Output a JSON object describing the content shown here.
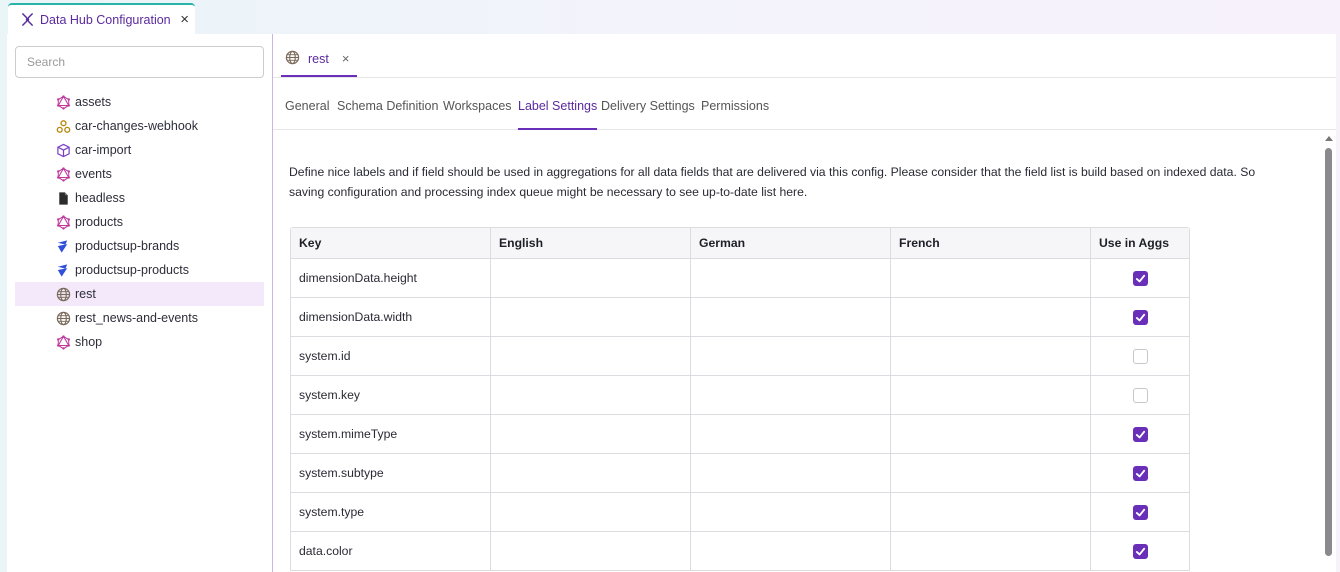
{
  "app_tab": {
    "title": "Data Hub Configuration",
    "icon": "datahub-sparkle-icon",
    "accent": "#28b5a8"
  },
  "search": {
    "placeholder": "Search",
    "value": ""
  },
  "tree": [
    {
      "label": "assets",
      "icon": "graphql-icon",
      "active": false
    },
    {
      "label": "car-changes-webhook",
      "icon": "webhook-icon",
      "active": false
    },
    {
      "label": "car-import",
      "icon": "cube-icon",
      "active": false
    },
    {
      "label": "events",
      "icon": "graphql-icon",
      "active": false
    },
    {
      "label": "headless",
      "icon": "document-icon",
      "active": false
    },
    {
      "label": "products",
      "icon": "graphql-icon",
      "active": false
    },
    {
      "label": "productsup-brands",
      "icon": "productsup-icon",
      "active": false
    },
    {
      "label": "productsup-products",
      "icon": "productsup-icon",
      "active": false
    },
    {
      "label": "rest",
      "icon": "globe-icon",
      "active": true
    },
    {
      "label": "rest_news-and-events",
      "icon": "globe-icon",
      "active": false
    },
    {
      "label": "shop",
      "icon": "graphql-icon",
      "active": false
    }
  ],
  "doc_tab": {
    "label": "rest",
    "icon": "globe-icon",
    "close": "×"
  },
  "sub_tabs": [
    {
      "label": "General",
      "active": false
    },
    {
      "label": "Schema Definition",
      "active": false
    },
    {
      "label": "Workspaces",
      "active": false
    },
    {
      "label": "Label Settings",
      "active": true
    },
    {
      "label": "Delivery Settings",
      "active": false
    },
    {
      "label": "Permissions",
      "active": false
    }
  ],
  "description": "Define nice labels and if field should be used in aggregations for all data fields that are delivered via this config. Please consider that the field list is build based on indexed data. So saving configuration and processing index queue might be necessary to see up-to-date list here.",
  "table": {
    "headers": [
      "Key",
      "English",
      "German",
      "French",
      "Use in Aggs"
    ],
    "rows": [
      {
        "key": "dimensionData.height",
        "english": "",
        "german": "",
        "french": "",
        "use_in_aggs": true
      },
      {
        "key": "dimensionData.width",
        "english": "",
        "german": "",
        "french": "",
        "use_in_aggs": true
      },
      {
        "key": "system.id",
        "english": "",
        "german": "",
        "french": "",
        "use_in_aggs": false
      },
      {
        "key": "system.key",
        "english": "",
        "german": "",
        "french": "",
        "use_in_aggs": false
      },
      {
        "key": "system.mimeType",
        "english": "",
        "german": "",
        "french": "",
        "use_in_aggs": true
      },
      {
        "key": "system.subtype",
        "english": "",
        "german": "",
        "french": "",
        "use_in_aggs": true
      },
      {
        "key": "system.type",
        "english": "",
        "german": "",
        "french": "",
        "use_in_aggs": true
      },
      {
        "key": "data.color",
        "english": "",
        "german": "",
        "french": "",
        "use_in_aggs": true
      }
    ]
  },
  "colors": {
    "accent": "#6a2fb8",
    "accent_text": "#5b2a9e",
    "active_bg": "#f3e9fa"
  }
}
